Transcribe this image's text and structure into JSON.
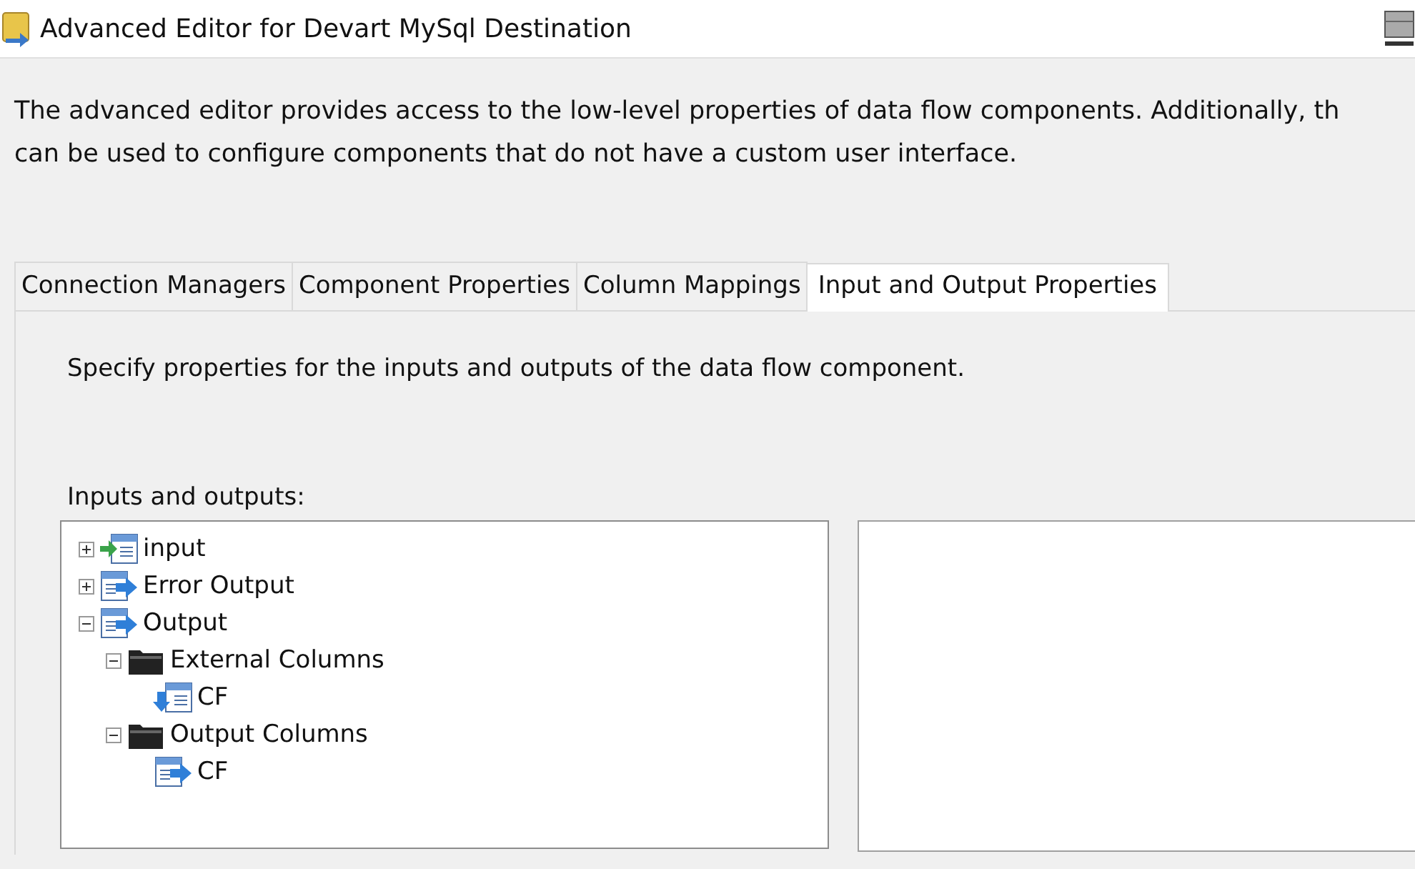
{
  "window": {
    "title": "Advanced Editor for Devart MySql Destination"
  },
  "description": "The advanced editor provides access to the low-level properties of data flow components. Additionally, th\ncan be used to configure components that do not have a custom user interface.",
  "tabs": [
    {
      "label": "Connection Managers",
      "selected": false
    },
    {
      "label": "Component Properties",
      "selected": false
    },
    {
      "label": "Column Mappings",
      "selected": false
    },
    {
      "label": "Input and Output Properties",
      "selected": true
    }
  ],
  "panel": {
    "instruction": "Specify properties for the inputs and outputs of the data flow component.",
    "tree_label": "Inputs and outputs:",
    "tree": [
      {
        "label": "input",
        "kind": "input",
        "expanded": false
      },
      {
        "label": "Error Output",
        "kind": "output",
        "expanded": false
      },
      {
        "label": "Output",
        "kind": "output",
        "expanded": true,
        "children": [
          {
            "label": "External Columns",
            "kind": "folder",
            "expanded": true,
            "children": [
              {
                "label": "CF",
                "kind": "external-column"
              }
            ]
          },
          {
            "label": "Output Columns",
            "kind": "folder",
            "expanded": true,
            "children": [
              {
                "label": "CF",
                "kind": "output-column"
              }
            ]
          }
        ]
      }
    ]
  }
}
